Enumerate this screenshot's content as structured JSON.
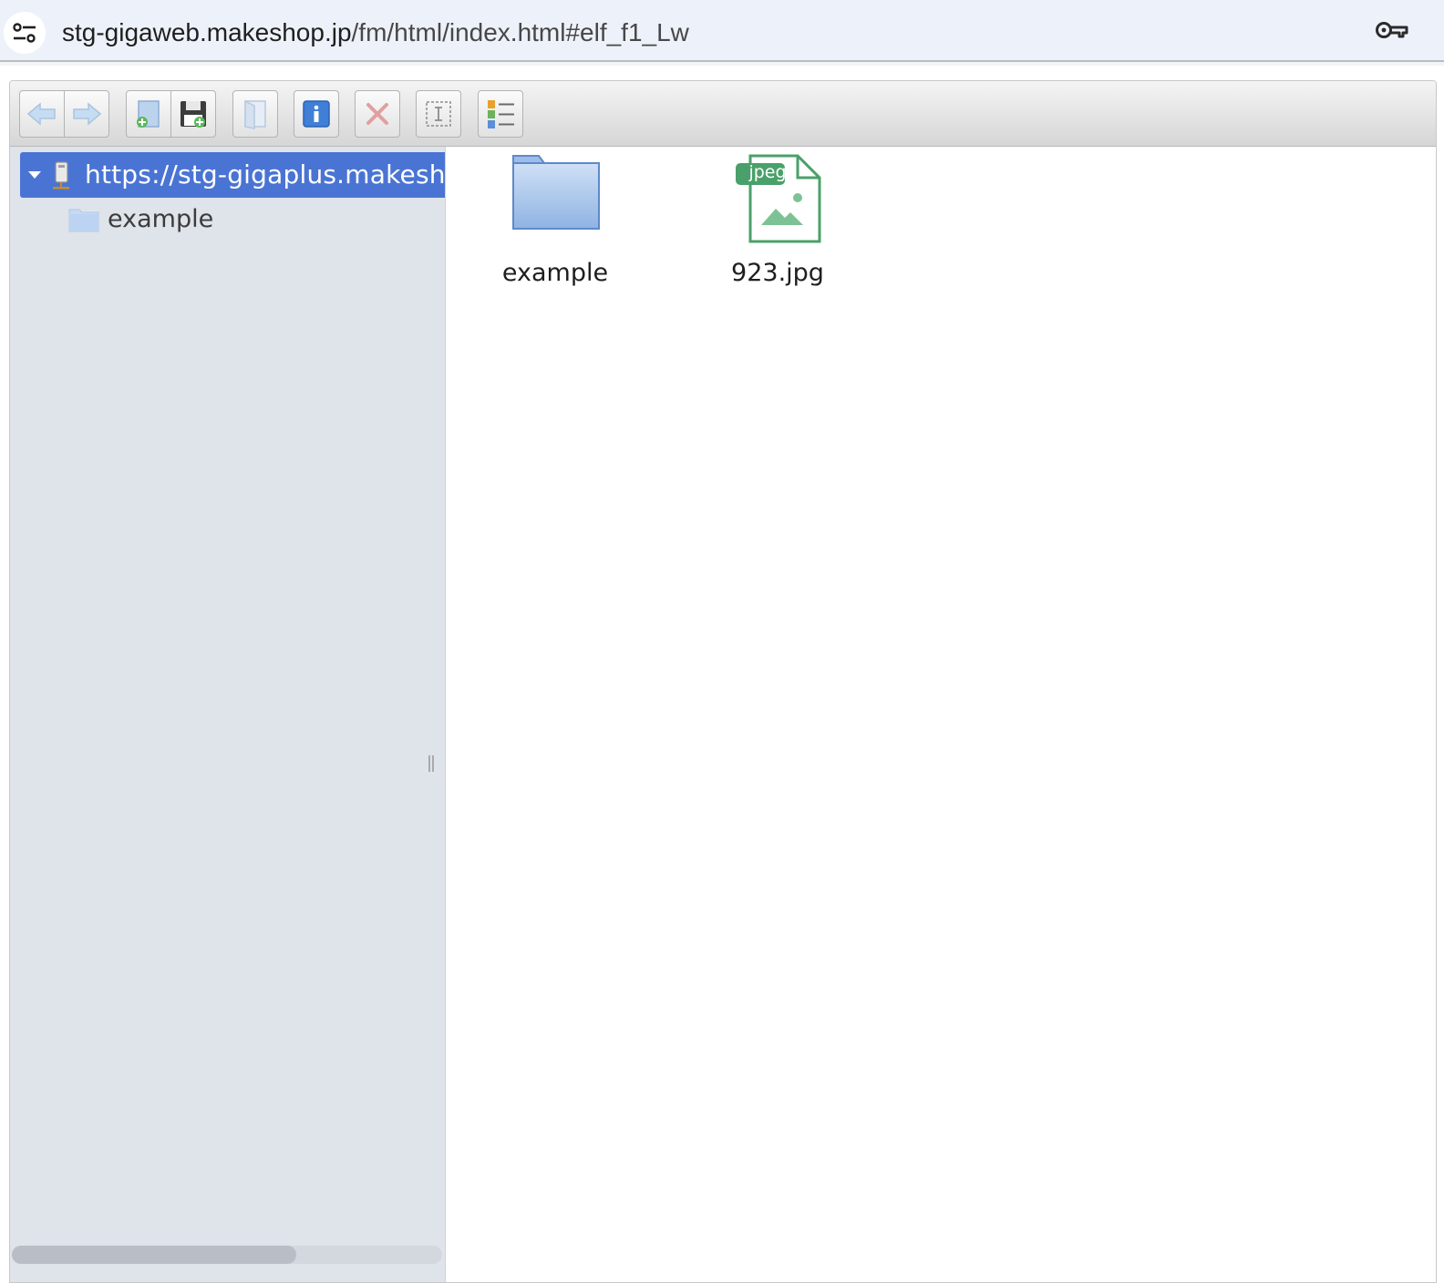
{
  "browser": {
    "url_host": "stg-gigaweb.makeshop.jp",
    "url_path": "/fm/html/index.html#elf_f1_Lw",
    "site_settings_icon": "tune-icon",
    "password_icon": "key-icon"
  },
  "toolbar": {
    "buttons": [
      {
        "name": "back",
        "icon": "arrow-left-icon"
      },
      {
        "name": "forward",
        "icon": "arrow-right-icon"
      },
      {
        "name": "upload",
        "icon": "upload-icon"
      },
      {
        "name": "download",
        "icon": "save-icon"
      },
      {
        "name": "open",
        "icon": "open-icon"
      },
      {
        "name": "info",
        "icon": "info-icon"
      },
      {
        "name": "delete",
        "icon": "close-icon"
      },
      {
        "name": "select",
        "icon": "select-icon"
      },
      {
        "name": "view",
        "icon": "list-view-icon"
      }
    ]
  },
  "tree": {
    "root_label": "https://stg-gigaplus.makeshop",
    "children": [
      {
        "label": "example"
      }
    ]
  },
  "files": [
    {
      "name": "example",
      "kind": "folder"
    },
    {
      "name": "923.jpg",
      "kind": "image",
      "badge": "jpeg"
    }
  ],
  "colors": {
    "selection": "#4a74d4",
    "navbar_bg": "#dfe3ea",
    "folder": "#7ea6dc",
    "jpeg_green": "#4aa06a"
  }
}
